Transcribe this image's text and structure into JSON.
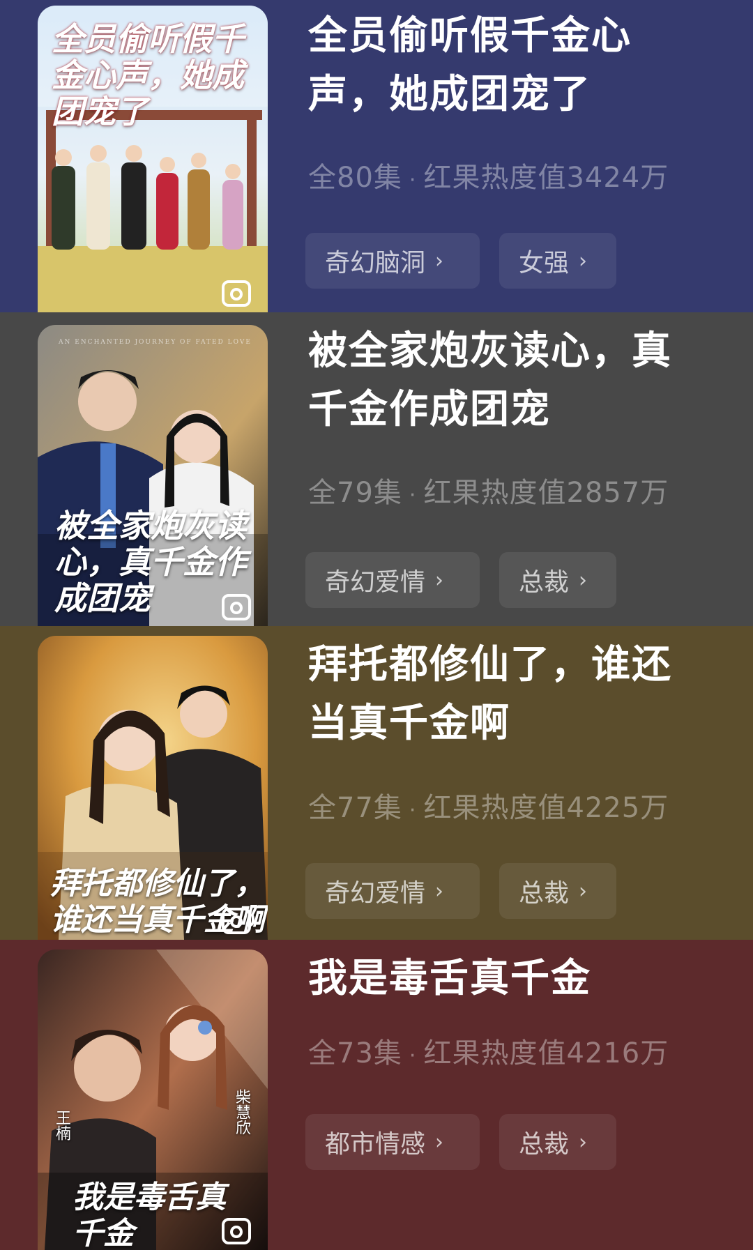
{
  "items": [
    {
      "title": "全员偷听假千金心声，她成团宠了",
      "episodes": "全80集",
      "heat": "红果热度值3424万",
      "tags": [
        "奇幻脑洞",
        "女强"
      ],
      "poster_title": "全员偷听假千金心声，她成团宠了",
      "poster_icon": "reel-icon",
      "colors": {
        "row": "#353a6e"
      }
    },
    {
      "title": "被全家炮灰读心，真千金作成团宠",
      "episodes": "全79集",
      "heat": "红果热度值2857万",
      "tags": [
        "奇幻爱情",
        "总裁"
      ],
      "poster_title": "被全家炮灰读心，真千金作成团宠",
      "poster_subtitle": "AN ENCHANTED JOURNEY OF FATED LOVE",
      "poster_icon": "reel-icon",
      "colors": {
        "row": "#484848"
      }
    },
    {
      "title": "拜托都修仙了，谁还当真千金啊",
      "episodes": "全77集",
      "heat": "红果热度值4225万",
      "tags": [
        "奇幻爱情",
        "总裁"
      ],
      "poster_title": "拜托都修仙了，谁还当真千金啊",
      "poster_icon": "reel-icon",
      "colors": {
        "row": "#5b4d2c"
      }
    },
    {
      "title": "我是毒舌真千金",
      "episodes": "全73集",
      "heat": "红果热度值4216万",
      "tags": [
        "都市情感",
        "总裁"
      ],
      "poster_title": "我是毒舌真千金",
      "poster_cast": [
        "王楠",
        "柴慧欣"
      ],
      "poster_icon": "reel-icon",
      "colors": {
        "row": "#5d2a2c"
      }
    }
  ],
  "chevron_icon": "chevron-right-icon",
  "separator": "·"
}
